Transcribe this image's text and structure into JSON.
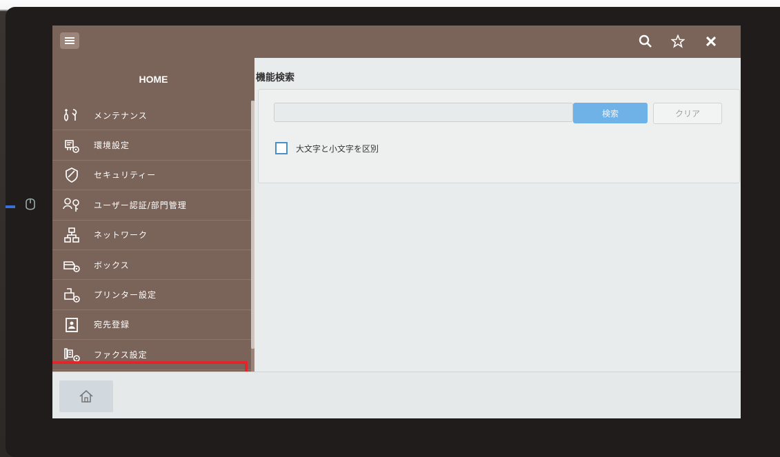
{
  "topbar": {
    "menu_icon": "hamburger-icon",
    "search_icon": "search-icon",
    "favorite_icon": "star-icon",
    "close_icon": "close-icon"
  },
  "sidebar": {
    "title": "HOME",
    "items": [
      {
        "label": "メンテナンス",
        "icon": "maintenance-icon"
      },
      {
        "label": "環境設定",
        "icon": "environment-settings-icon"
      },
      {
        "label": "セキュリティー",
        "icon": "security-icon"
      },
      {
        "label": "ユーザー認証/部門管理",
        "icon": "user-auth-icon"
      },
      {
        "label": "ネットワーク",
        "icon": "network-icon"
      },
      {
        "label": "ボックス",
        "icon": "box-icon"
      },
      {
        "label": "プリンター設定",
        "icon": "printer-settings-icon"
      },
      {
        "label": "宛先登録",
        "icon": "address-book-icon"
      },
      {
        "label": "ファクス設定",
        "icon": "fax-settings-icon"
      }
    ],
    "highlighted_item": "ファクス設定"
  },
  "main": {
    "title": "機能検索",
    "search": {
      "value": "",
      "placeholder": ""
    },
    "search_button": "検索",
    "clear_button": "クリア",
    "case_checkbox": {
      "label": "大文字と小文字を区別",
      "checked": false
    }
  },
  "bottombar": {
    "home_icon": "home-icon"
  },
  "colors": {
    "panel_brown": "#7a6358",
    "search_blue": "#6fb2e8",
    "highlight_red": "#e3242b"
  }
}
